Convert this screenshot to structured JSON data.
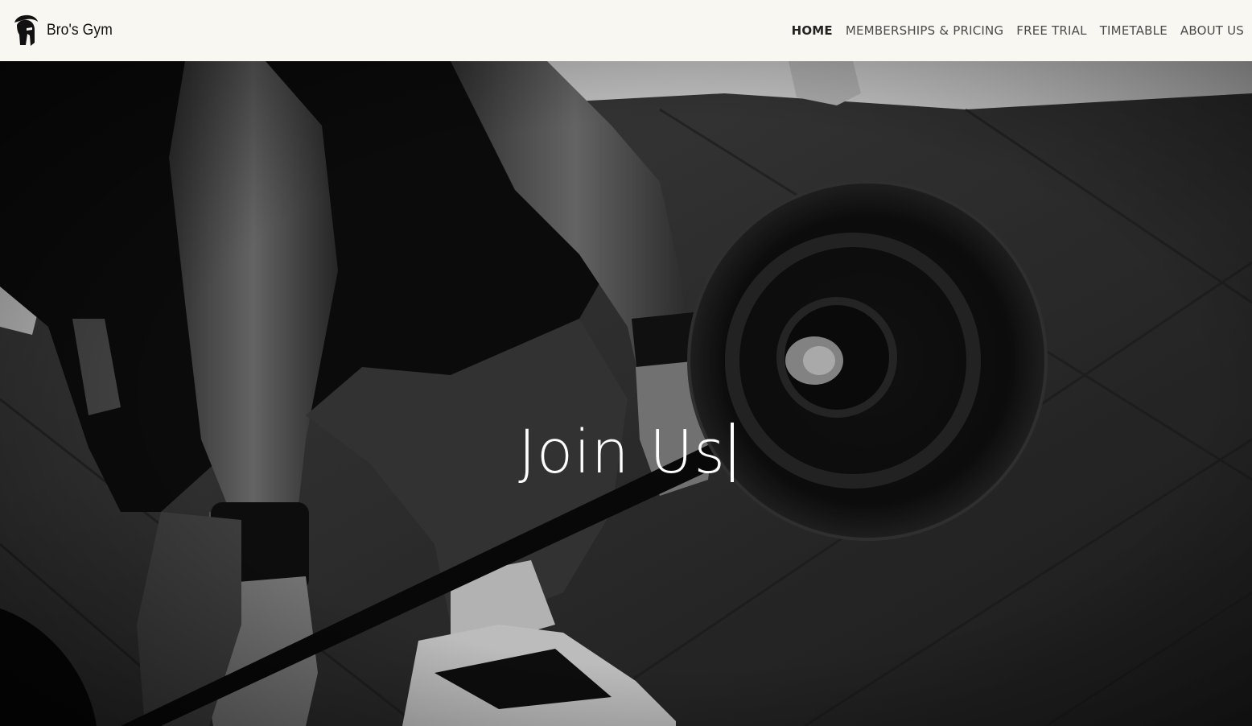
{
  "brand": {
    "name": "Bro's Gym",
    "logo_icon": "spartan-helmet-icon"
  },
  "nav": {
    "items": [
      {
        "label": "HOME",
        "active": true
      },
      {
        "label": "MEMBERSHIPS & PRICING",
        "active": false
      },
      {
        "label": "FREE TRIAL",
        "active": false
      },
      {
        "label": "TIMETABLE",
        "active": false
      },
      {
        "label": "ABOUT US",
        "active": false
      }
    ]
  },
  "hero": {
    "title": "Join Us",
    "background_image": "black-and-white deadlift photo: athlete gripping loaded barbell with plate on gym floor"
  },
  "colors": {
    "navbar_bg": "#f9f7f1",
    "nav_text": "#4a4a4a",
    "hero_text": "#ffffff"
  }
}
